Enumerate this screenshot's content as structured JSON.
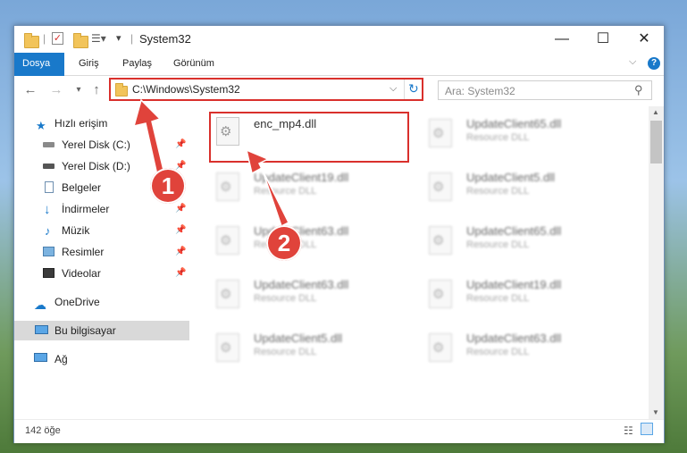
{
  "window": {
    "title": "System32",
    "controls": {
      "minimize": "—",
      "maximize": "☐",
      "close": "✕"
    }
  },
  "ribbon": {
    "tabs": [
      "Dosya",
      "Giriş",
      "Paylaş",
      "Görünüm"
    ],
    "help": "?"
  },
  "address": {
    "path": "C:\\Windows\\System32"
  },
  "search": {
    "placeholder": "Ara: System32"
  },
  "sidebar": {
    "items": [
      {
        "label": "Hızlı erişim",
        "icon": "star-icon"
      },
      {
        "label": "Yerel Disk (C:)",
        "icon": "drive-icon",
        "pinned": true
      },
      {
        "label": "Yerel Disk (D:)",
        "icon": "drive-icon",
        "pinned": true
      },
      {
        "label": "Belgeler",
        "icon": "documents-icon",
        "pinned": true
      },
      {
        "label": "İndirmeler",
        "icon": "download-icon",
        "pinned": true
      },
      {
        "label": "Müzik",
        "icon": "music-icon",
        "pinned": true
      },
      {
        "label": "Resimler",
        "icon": "pictures-icon",
        "pinned": true
      },
      {
        "label": "Videolar",
        "icon": "videos-icon",
        "pinned": true
      },
      {
        "label": "OneDrive",
        "icon": "cloud-icon"
      },
      {
        "label": "Bu bilgisayar",
        "icon": "computer-icon",
        "selected": true
      },
      {
        "label": "Ağ",
        "icon": "network-icon"
      }
    ]
  },
  "files": {
    "highlighted": {
      "name": "enc_mp4.dll"
    },
    "others": [
      {
        "name": "UpdateClient65.dll",
        "type": "Resource DLL"
      },
      {
        "name": "UpdateClient19.dll",
        "type": "Resource DLL"
      },
      {
        "name": "UpdateClient5.dll",
        "type": "Resource DLL"
      },
      {
        "name": "UpdateClient63.dll",
        "type": "Resource DLL"
      },
      {
        "name": "UpdateClient65.dll",
        "type": "Resource DLL"
      },
      {
        "name": "UpdateClient63.dll",
        "type": "Resource DLL"
      },
      {
        "name": "UpdateClient19.dll",
        "type": "Resource DLL"
      },
      {
        "name": "UpdateClient5.dll",
        "type": "Resource DLL"
      },
      {
        "name": "UpdateClient63.dll",
        "type": "Resource DLL"
      }
    ]
  },
  "status": {
    "count": "142 öğe"
  },
  "annotations": {
    "step1": "1",
    "step2": "2",
    "color": "#e0433b"
  }
}
